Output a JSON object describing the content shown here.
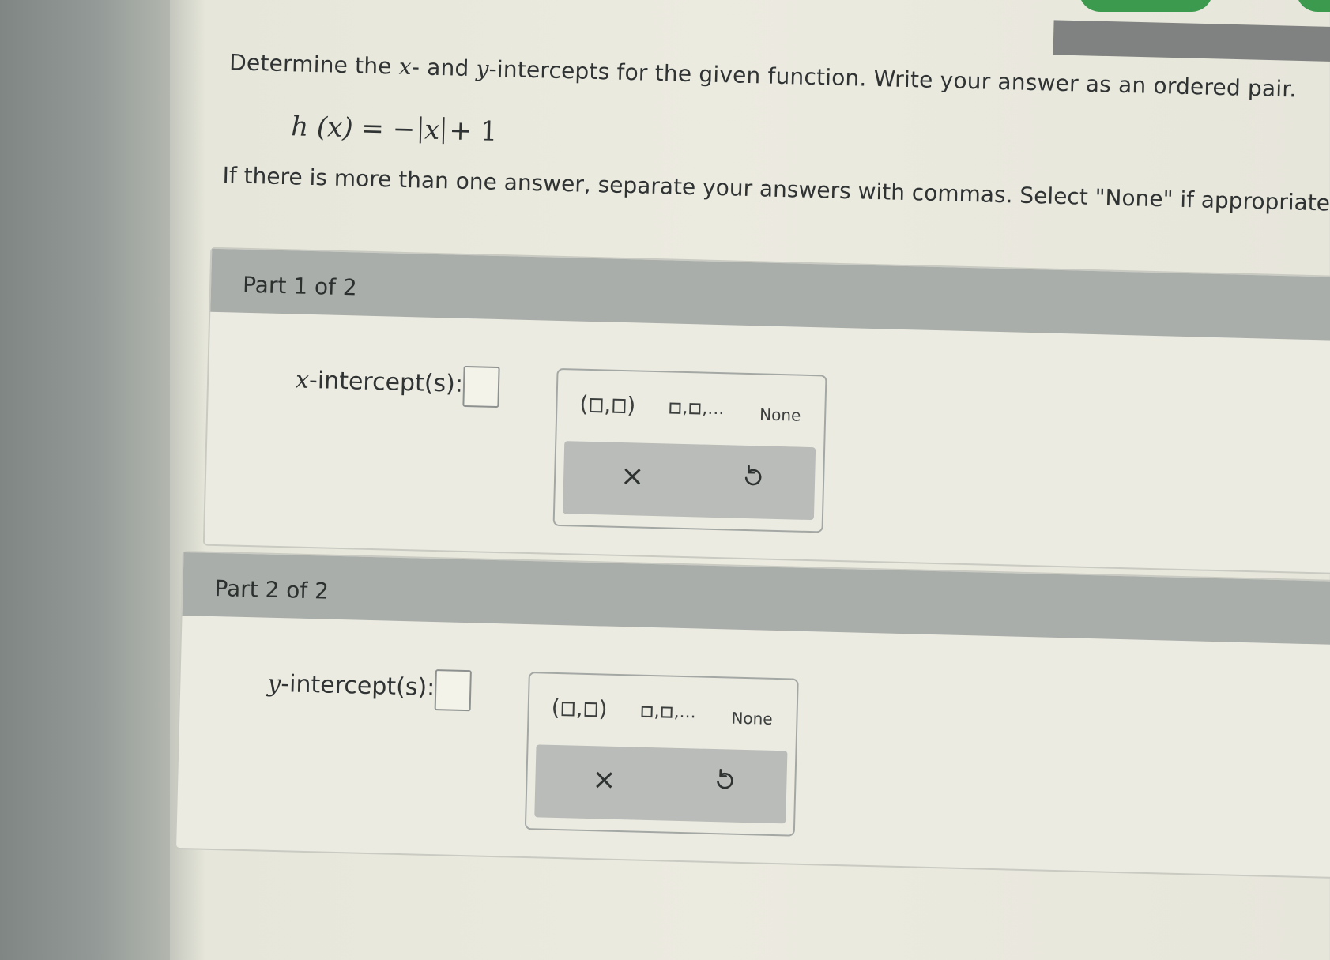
{
  "question": {
    "part_a": "Determine the ",
    "var_x": "x",
    "part_b": "- and ",
    "var_y": "y",
    "part_c": "-intercepts for the given function. Write your answer as an ordered pair."
  },
  "formula": {
    "lhs": "h (x) = −",
    "abs_var": "x",
    "rhs": "+ 1"
  },
  "instructions": "If there is more than one answer, separate your answers with commas. Select \"None\" if appropriate.",
  "parts": [
    {
      "header": "Part 1 of 2",
      "label_var": "x",
      "label_text": "-intercept(s):",
      "keypad": {
        "pair_open": "(",
        "pair_comma": ",",
        "pair_close": ")",
        "list_suffix": ",...",
        "list_comma": ",",
        "none_label": "None",
        "clear_symbol": "×"
      }
    },
    {
      "header": "Part 2 of 2",
      "label_var": "y",
      "label_text": "-intercept(s):",
      "keypad": {
        "pair_open": "(",
        "pair_comma": ",",
        "pair_close": ")",
        "list_suffix": ",...",
        "list_comma": ",",
        "none_label": "None",
        "clear_symbol": "×"
      }
    }
  ],
  "colors": {
    "panel_header": "#a9aeaa",
    "keypad_bottom": "#b9bcb8",
    "accent_green": "#3c9a4e"
  },
  "icons": {
    "clear": "close-icon",
    "undo": "undo-icon"
  }
}
